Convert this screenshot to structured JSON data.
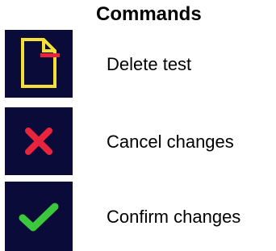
{
  "title": "Commands",
  "colors": {
    "icon_background": "#0b0b3a",
    "document_icon": "#f5e03a",
    "delete_mark": "#e8243c",
    "cancel_icon": "#e8243c",
    "confirm_icon": "#3cc83c"
  },
  "commands": [
    {
      "label": "Delete test",
      "icon": "document-delete-icon"
    },
    {
      "label": "Cancel changes",
      "icon": "cancel-x-icon"
    },
    {
      "label": "Confirm changes",
      "icon": "confirm-check-icon"
    }
  ]
}
